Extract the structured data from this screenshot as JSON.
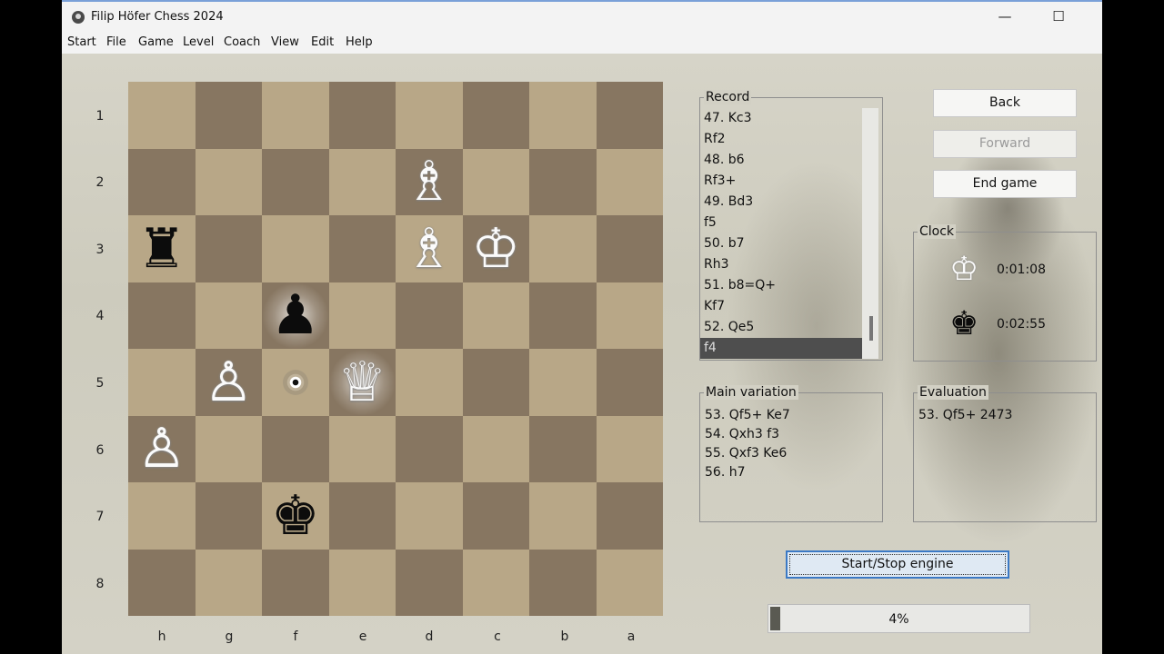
{
  "window": {
    "title": "Filip Höfer Chess 2024",
    "minimize_glyph": "—",
    "maximize_glyph": "☐"
  },
  "menu": [
    "Start",
    "File",
    "Game",
    "Level",
    "Coach",
    "View",
    "Edit",
    "Help"
  ],
  "board": {
    "ranks": [
      "1",
      "2",
      "3",
      "4",
      "5",
      "6",
      "7",
      "8"
    ],
    "files": [
      "h",
      "g",
      "f",
      "e",
      "d",
      "c",
      "b",
      "a"
    ],
    "light_color": "#b8a787",
    "dark_color": "#877661",
    "pieces": [
      {
        "square": "d2",
        "type": "bishop",
        "color": "white",
        "glyph": "♗"
      },
      {
        "square": "d3",
        "type": "bishop",
        "color": "white",
        "glyph": "♗"
      },
      {
        "square": "c3",
        "type": "king",
        "color": "white",
        "glyph": "♔"
      },
      {
        "square": "h3",
        "type": "rook",
        "color": "black",
        "glyph": "♜"
      },
      {
        "square": "f4",
        "type": "pawn",
        "color": "black",
        "glyph": "♟",
        "highlight": true
      },
      {
        "square": "g5",
        "type": "pawn",
        "color": "white",
        "glyph": "♙"
      },
      {
        "square": "e5",
        "type": "queen",
        "color": "white",
        "glyph": "♕",
        "highlight": true
      },
      {
        "square": "h6",
        "type": "pawn",
        "color": "white",
        "glyph": "♙"
      },
      {
        "square": "f7",
        "type": "king",
        "color": "black",
        "glyph": "♚"
      }
    ],
    "move_target_square": "f5"
  },
  "record": {
    "title": "Record",
    "items": [
      "47. Kc3",
      "Rf2",
      "48. b6",
      "Rf3+",
      "49. Bd3",
      "f5",
      "50. b7",
      "Rh3",
      "51. b8=Q+",
      "Kf7",
      "52. Qe5",
      "f4"
    ],
    "selected_index": 11
  },
  "buttons": {
    "back": "Back",
    "forward": "Forward",
    "end_game": "End game",
    "engine": "Start/Stop engine"
  },
  "clock": {
    "title": "Clock",
    "white_time": "0:01:08",
    "black_time": "0:02:55",
    "white_icon": "♔",
    "black_icon": "♚"
  },
  "main_variation": {
    "title": "Main variation",
    "lines": [
      "53. Qf5+ Ke7",
      "54. Qxh3 f3",
      "55. Qxf3 Ke6",
      "56. h7"
    ]
  },
  "evaluation": {
    "title": "Evaluation",
    "lines": [
      "53. Qf5+ 2473"
    ]
  },
  "progress": {
    "label": "4%",
    "value": 0.04
  }
}
